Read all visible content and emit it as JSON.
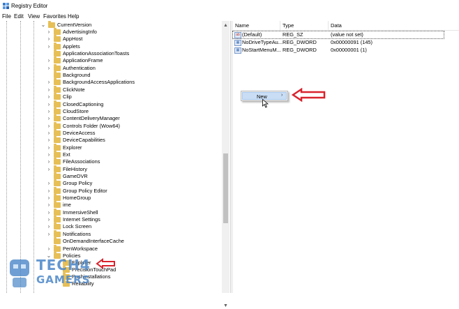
{
  "window": {
    "title": "Registry Editor",
    "icon": "registry-icon"
  },
  "menubar": [
    "File",
    "Edit",
    "View",
    "Favorites",
    "Help"
  ],
  "tree": {
    "parent": "CurrentVersion",
    "items": [
      {
        "label": "AdvertisingInfo",
        "expander": "chevron-right"
      },
      {
        "label": "AppHost",
        "expander": "chevron-right"
      },
      {
        "label": "Applets",
        "expander": "chevron-right"
      },
      {
        "label": "ApplicationAssociationToasts",
        "expander": "none"
      },
      {
        "label": "ApplicationFrame",
        "expander": "chevron-right"
      },
      {
        "label": "Authentication",
        "expander": "chevron-right"
      },
      {
        "label": "Background",
        "expander": "none"
      },
      {
        "label": "BackgroundAccessApplications",
        "expander": "chevron-right"
      },
      {
        "label": "ClickNote",
        "expander": "chevron-right"
      },
      {
        "label": "Clip",
        "expander": "chevron-right"
      },
      {
        "label": "ClosedCaptioning",
        "expander": "chevron-right"
      },
      {
        "label": "CloudStore",
        "expander": "chevron-right"
      },
      {
        "label": "ContentDeliveryManager",
        "expander": "chevron-right"
      },
      {
        "label": "Controls Folder (Wow64)",
        "expander": "chevron-right"
      },
      {
        "label": "DeviceAccess",
        "expander": "chevron-right"
      },
      {
        "label": "DeviceCapabilities",
        "expander": "chevron-right"
      },
      {
        "label": "Explorer",
        "expander": "chevron-right"
      },
      {
        "label": "Ext",
        "expander": "chevron-right"
      },
      {
        "label": "FileAssociations",
        "expander": "chevron-right"
      },
      {
        "label": "FileHistory",
        "expander": "chevron-right"
      },
      {
        "label": "GameDVR",
        "expander": "none"
      },
      {
        "label": "Group Policy",
        "expander": "chevron-right"
      },
      {
        "label": "Group Policy Editor",
        "expander": "chevron-right"
      },
      {
        "label": "HomeGroup",
        "expander": "chevron-right"
      },
      {
        "label": "ime",
        "expander": "chevron-right"
      },
      {
        "label": "ImmersiveShell",
        "expander": "chevron-right"
      },
      {
        "label": "Internet Settings",
        "expander": "chevron-right"
      },
      {
        "label": "Lock Screen",
        "expander": "chevron-right"
      },
      {
        "label": "Notifications",
        "expander": "chevron-right"
      },
      {
        "label": "OnDemandInterfaceCache",
        "expander": "none"
      },
      {
        "label": "PenWorkspace",
        "expander": "chevron-right"
      },
      {
        "label": "Policies",
        "expander": "chevron-down"
      }
    ],
    "child_selected": "Explorer",
    "partial_rows": [
      "PrecisionTouchPad",
      "Pushinstallations",
      "Reliability"
    ]
  },
  "columns": {
    "name": "Name",
    "type": "Type",
    "data": "Data"
  },
  "values": [
    {
      "name": "(Default)",
      "type": "REG_SZ",
      "data": "(value not set)",
      "icon": "ab-string-icon"
    },
    {
      "name": "NoDriveTypeAu...",
      "type": "REG_DWORD",
      "data": "0x00000091 (145)",
      "icon": "binary-value-icon"
    },
    {
      "name": "NoStartMenuM...",
      "type": "REG_DWORD",
      "data": "0x00000001 (1)",
      "icon": "binary-value-icon"
    }
  ],
  "context_menu": {
    "label": "New",
    "submenu_icon": "chevron-right-icon"
  },
  "watermark": {
    "line1": "TECH4",
    "line2": "GAMERS"
  },
  "colors": {
    "folder": "#e6bf57",
    "annotation_arrow": "#d9232d",
    "menu_highlight": "#c9def5",
    "watermark": "#4a86c8"
  }
}
